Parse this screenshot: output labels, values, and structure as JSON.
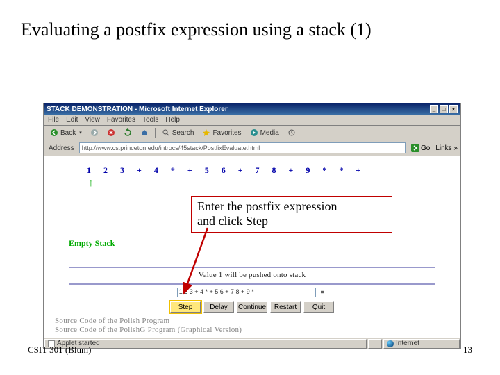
{
  "slide": {
    "title": "Evaluating a postfix expression using a stack (1)",
    "footer_left": "CSIT 301 (Blum)",
    "footer_right": "13"
  },
  "browser": {
    "window_title": "STACK DEMONSTRATION - Microsoft Internet Explorer",
    "menu": [
      "File",
      "Edit",
      "View",
      "Favorites",
      "Tools",
      "Help"
    ],
    "toolbar": {
      "back": "Back",
      "search": "Search",
      "favorites": "Favorites",
      "media": "Media"
    },
    "address_label": "Address",
    "address_value": "http://www.cs.princeton.edu/introcs/45stack/PostfixEvaluate.html",
    "go": "Go",
    "links": "Links »"
  },
  "applet": {
    "tokens": [
      "1",
      "2",
      "3",
      "+",
      "4",
      "*",
      "+",
      "5",
      "6",
      "+",
      "7",
      "8",
      "+",
      "9",
      "*",
      "*",
      "+"
    ],
    "pointer": "↑",
    "stack_label": "Empty Stack",
    "push_msg": "Value 1 will be pushed onto stack",
    "input_value": "1 2 3 + 4 * + 5 6 + 7 8 + 9 *",
    "equals": "=",
    "buttons": {
      "step": "Step",
      "delay": "Delay",
      "continue": "Continue",
      "restart": "Restart",
      "quit": "Quit"
    },
    "src1": "Source Code of the Polish Program",
    "src2": "Source Code of the PolishG Program (Graphical Version)"
  },
  "callout": {
    "line1": "Enter the postfix expression",
    "line2": "and click Step"
  },
  "status": {
    "applet": "Applet started",
    "zone": "Internet"
  }
}
